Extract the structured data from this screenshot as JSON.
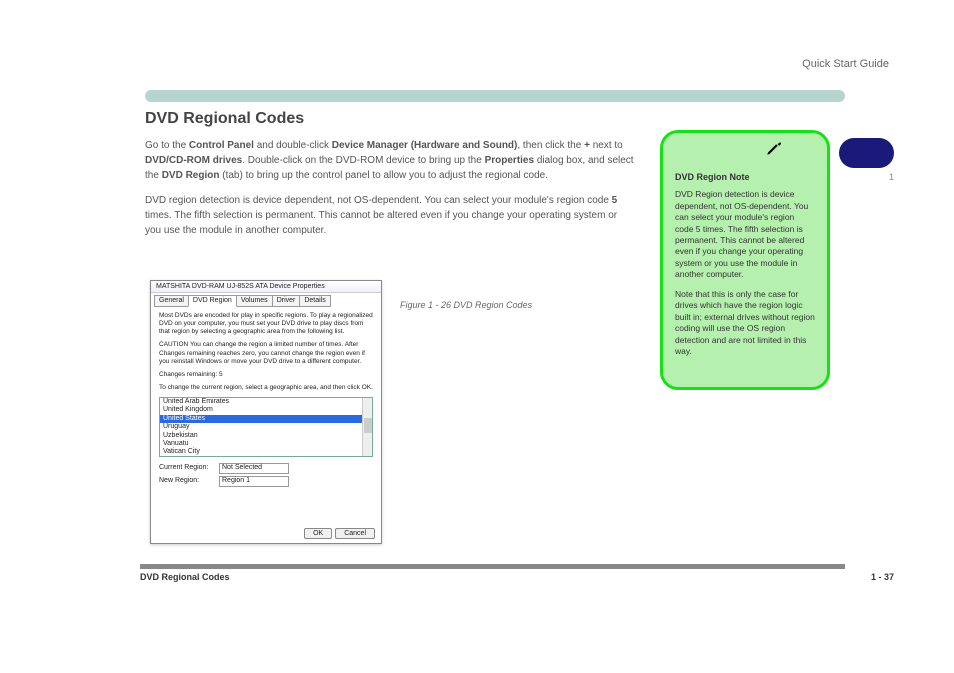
{
  "header": {
    "chapter_badge": "Quick Start Guide",
    "section_title": "DVD Regional Codes",
    "nav_label": "1",
    "section_number": "1"
  },
  "body": {
    "para1_prefix": "Go to the ",
    "para1_bold1": "Control Panel",
    "para1_mid1": " and double-click ",
    "para1_bold2": "Device Manager (Hardware and Sound)",
    "para1_mid2": ", then click the ",
    "para1_bold3": "+",
    "para1_mid3": " next to ",
    "para1_bold4": "DVD/CD-ROM drives",
    "para1_end": ". Double-click on the DVD-ROM device to bring up the ",
    "para1_bold5": "Properties",
    "para1_mid4": " dialog box, and select the ",
    "para1_bold6": "DVD Region",
    "para1_tail": " (tab) to bring up the control panel to allow you to adjust the regional code.",
    "para2_prefix": "DVD region detection is device dependent, not OS-dependent. You can select your module's region code ",
    "para2_bold": "5",
    "para2_suffix": " times. The fifth selection is permanent. This cannot be altered even if you change your operating system or you use the module in another computer."
  },
  "caption": "Figure 1 - 26\nDVD Region Codes",
  "dialog": {
    "title": "MATSHITA DVD-RAM UJ-852S ATA Device Properties",
    "tabs": [
      "General",
      "DVD Region",
      "Volumes",
      "Driver",
      "Details"
    ],
    "active_tab": 1,
    "p1": "Most DVDs are encoded for play in specific regions. To play a regionalized DVD on your computer, you must set your DVD drive to play discs from that region by selecting a geographic area from the following list.",
    "caution": "CAUTION   You can change the region a limited number of times. After Changes remaining reaches zero, you cannot change the region even if you reinstall Windows or move your DVD drive to a different computer.",
    "remaining_label": "Changes remaining: 5",
    "instruction": "To change the current region, select a geographic area, and then click OK.",
    "list": [
      "United Arab Emirates",
      "United Kingdom",
      "United States",
      "Uruguay",
      "Uzbekistan",
      "Vanuatu",
      "Vatican City"
    ],
    "selected_index": 2,
    "current_label": "Current Region:",
    "current_value": "Not Selected",
    "new_label": "New Region:",
    "new_value": "Region 1",
    "ok": "OK",
    "cancel": "Cancel"
  },
  "note": {
    "title": "DVD Region Note",
    "p1": "DVD Region detection is device dependent, not OS-dependent. You can select your module's region code 5 times. The fifth selection is permanent. This cannot be altered even if you change your operating system or you use the module in another computer.",
    "p2": "Note that this is only the case for drives which have the region logic built in; external drives without region coding will use the OS region detection and are not limited in this way."
  },
  "footer": {
    "chapter": "DVD Regional Codes",
    "page": "1 - 37"
  }
}
